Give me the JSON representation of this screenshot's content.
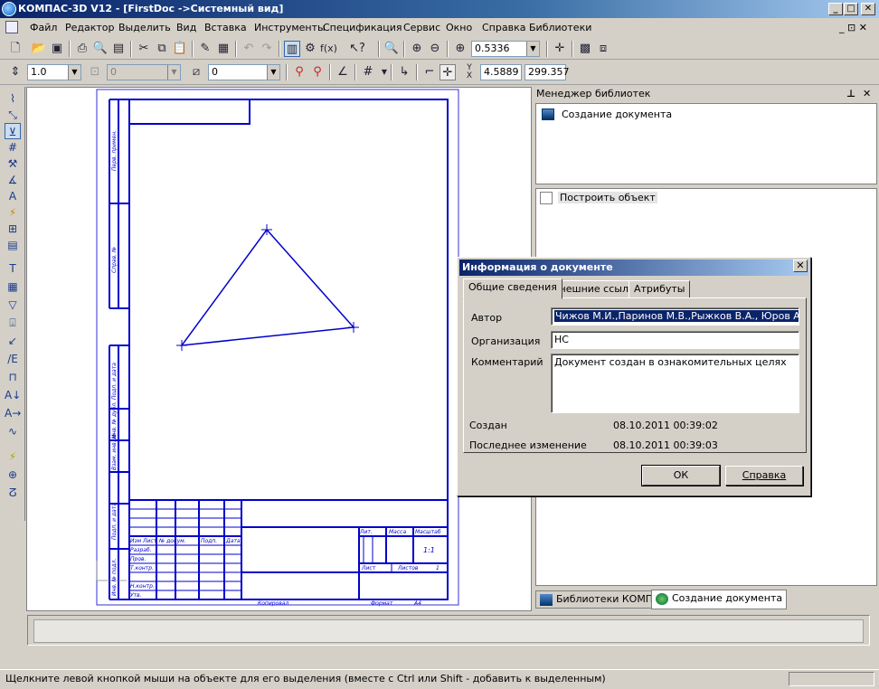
{
  "window": {
    "title": "КОМПАС-3D V12 - [FirstDoc ->Системный вид]",
    "minimize": "_",
    "maximize": "□",
    "close": "✕"
  },
  "menu": {
    "items": [
      "Файл",
      "Редактор",
      "Выделить",
      "Вид",
      "Вставка",
      "Инструменты",
      "Спецификация",
      "Сервис",
      "Окно",
      "Справка",
      "Библиотеки"
    ],
    "doc_controls": "_ ⊡ ✕"
  },
  "toolbar1": {
    "zoom_value": "0.5336"
  },
  "toolbar2": {
    "scale_value": "1.0",
    "layer_value": "0",
    "style_value": "0",
    "y_coord_label": "Y",
    "x_coord_label": "X",
    "coord_value1": "4.5889",
    "coord_value2": "299.357"
  },
  "library_manager": {
    "title": "Менеджер библиотек",
    "pin": "⊥",
    "close": "✕",
    "tree_item": "Создание документа",
    "build_object": "Построить объект",
    "tab_libraries": "Библиотеки КОМПАС",
    "tab_create": "Создание документа"
  },
  "drawing": {
    "stamp_labels": {
      "lit": "Лит.",
      "mass": "Масса",
      "scale": "Масштаб",
      "scale_value": "1:1",
      "sheet": "Лист",
      "sheets": "Листов",
      "sheets_value": "1",
      "izm": "Изм",
      "list": "Лист",
      "doc_no": "№ докум.",
      "sign": "Подп.",
      "date": "Дата",
      "razrab": "Разраб.",
      "prov": "Пров.",
      "tkontr": "Т.контр.",
      "nkontr": "Н.контр.",
      "utv": "Утв.",
      "copied": "Копировал",
      "format": "Формат",
      "format_value": "A4"
    },
    "side_labels": [
      "Перв. примен.",
      "Справ. №",
      "Подп. и дата",
      "Инв. № дубл.",
      "Взам. инв. №",
      "Подп. и дата",
      "Инв. № подл."
    ]
  },
  "dialog": {
    "title": "Информация о документе",
    "close": "✕",
    "tabs": [
      "Общие сведения",
      "Внешние ссылки",
      "Атрибуты"
    ],
    "author_label": "Автор",
    "author_value": "Чижов М.И.,Паринов М.В.,Рыжков В.А., Юров А.Н.",
    "org_label": "Организация",
    "org_value": "НС",
    "comment_label": "Комментарий",
    "comment_value": "Документ создан в ознакомительных целях",
    "created_label": "Создан",
    "created_value": "08.10.2011  00:39:02",
    "modified_label": "Последнее изменение",
    "modified_value": "08.10.2011  00:39:03",
    "ok": "ОК",
    "help": "Справка"
  },
  "status": {
    "hint": "Щелкните левой кнопкой мыши на объекте для его выделения (вместе с Ctrl или Shift - добавить к выделенным)"
  }
}
